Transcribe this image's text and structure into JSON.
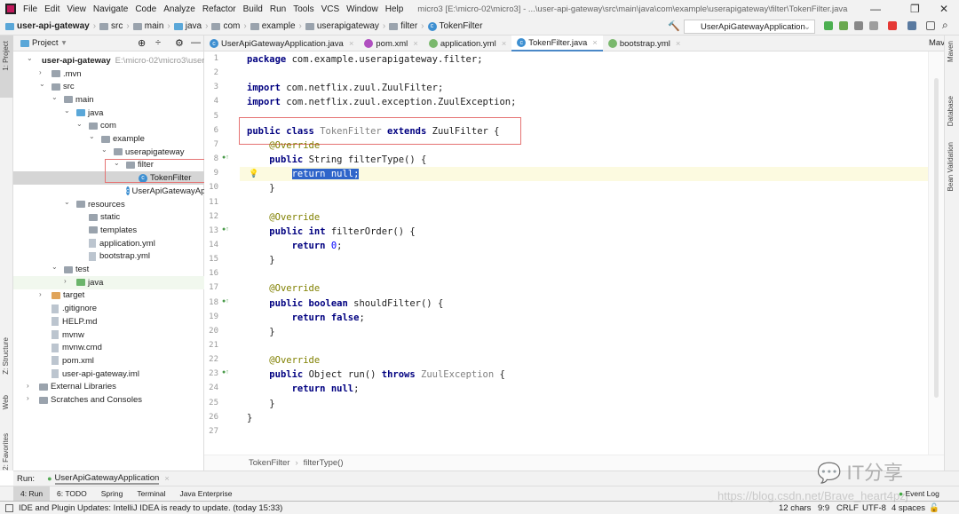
{
  "menu": {
    "items": [
      "File",
      "Edit",
      "View",
      "Navigate",
      "Code",
      "Analyze",
      "Refactor",
      "Build",
      "Run",
      "Tools",
      "VCS",
      "Window",
      "Help"
    ],
    "title": "micro3 [E:\\micro-02\\micro3] - ...\\user-api-gateway\\src\\main\\java\\com\\example\\userapigateway\\filter\\TokenFilter.java"
  },
  "nav": {
    "crumbs": [
      "user-api-gateway",
      "src",
      "main",
      "java",
      "com",
      "example",
      "userapigateway",
      "filter",
      "TokenFilter"
    ],
    "run_config": "UserApiGatewayApplication"
  },
  "left_stripe": {
    "project": "1: Project",
    "structure": "Z: Structure",
    "web": "Web",
    "favorites": "2: Favorites"
  },
  "right_stripe": {
    "maven": "Maven",
    "database": "Database",
    "bean": "Bean Validation"
  },
  "project": {
    "header": "Project",
    "tree": [
      {
        "label": "user-api-gateway",
        "hint": "E:\\micro-02\\micro3\\user-a",
        "depth": 0,
        "open": true,
        "bold": true
      },
      {
        "label": ".mvn",
        "depth": 1,
        "open": false
      },
      {
        "label": "src",
        "depth": 1,
        "open": true
      },
      {
        "label": "main",
        "depth": 2,
        "open": true
      },
      {
        "label": "java",
        "depth": 3,
        "open": true,
        "blue": true
      },
      {
        "label": "com",
        "depth": 4,
        "open": true
      },
      {
        "label": "example",
        "depth": 5,
        "open": true
      },
      {
        "label": "userapigateway",
        "depth": 6,
        "open": true
      },
      {
        "label": "filter",
        "depth": 7,
        "open": true
      },
      {
        "label": "TokenFilter",
        "depth": 8,
        "cls": true,
        "selected": true
      },
      {
        "label": "UserApiGatewayAppl",
        "depth": 7,
        "cls": true
      },
      {
        "label": "resources",
        "depth": 3,
        "open": true
      },
      {
        "label": "static",
        "depth": 4
      },
      {
        "label": "templates",
        "depth": 4
      },
      {
        "label": "application.yml",
        "depth": 4,
        "file": true
      },
      {
        "label": "bootstrap.yml",
        "depth": 4,
        "file": true
      },
      {
        "label": "test",
        "depth": 2,
        "open": true
      },
      {
        "label": "java",
        "depth": 3,
        "open": false,
        "green": true
      },
      {
        "label": "target",
        "depth": 1,
        "open": false,
        "orange": true
      },
      {
        "label": ".gitignore",
        "depth": 1,
        "file": true
      },
      {
        "label": "HELP.md",
        "depth": 1,
        "file": true
      },
      {
        "label": "mvnw",
        "depth": 1,
        "file": true
      },
      {
        "label": "mvnw.cmd",
        "depth": 1,
        "file": true
      },
      {
        "label": "pom.xml",
        "depth": 1,
        "file": true
      },
      {
        "label": "user-api-gateway.iml",
        "depth": 1,
        "file": true
      },
      {
        "label": "External Libraries",
        "depth": 0,
        "open": false
      },
      {
        "label": "Scratches and Consoles",
        "depth": 0,
        "open": false
      }
    ]
  },
  "tabs": [
    {
      "label": "UserApiGatewayApplication.java"
    },
    {
      "label": "pom.xml"
    },
    {
      "label": "application.yml"
    },
    {
      "label": "TokenFilter.java",
      "active": true
    },
    {
      "label": "bootstrap.yml"
    }
  ],
  "tabs_right": "Mav",
  "code": [
    [
      [
        "package ",
        "kw"
      ],
      [
        "com.example.userapigateway.filter;",
        ""
      ]
    ],
    [],
    [
      [
        "import ",
        "kw"
      ],
      [
        "com.netflix.zuul.ZuulFilter;",
        ""
      ]
    ],
    [
      [
        "import ",
        "kw"
      ],
      [
        "com.netflix.zuul.exception.ZuulException;",
        ""
      ]
    ],
    [],
    [
      [
        "public class ",
        "kw"
      ],
      [
        "TokenFilter ",
        "gr"
      ],
      [
        "extends ",
        "kw"
      ],
      [
        "ZuulFilter {",
        ""
      ]
    ],
    [
      [
        "    ",
        ""
      ],
      [
        "@Override",
        "an"
      ]
    ],
    [
      [
        "    ",
        ""
      ],
      [
        "public ",
        "kw"
      ],
      [
        "String filterType() {",
        ""
      ]
    ],
    [
      [
        "        ",
        ""
      ],
      [
        "return null;",
        "selc"
      ]
    ],
    [
      [
        "    }",
        ""
      ]
    ],
    [],
    [
      [
        "    ",
        ""
      ],
      [
        "@Override",
        "an"
      ]
    ],
    [
      [
        "    ",
        ""
      ],
      [
        "public int ",
        "kw"
      ],
      [
        "filterOrder() {",
        ""
      ]
    ],
    [
      [
        "        ",
        ""
      ],
      [
        "return ",
        "kw"
      ],
      [
        "0",
        "nm"
      ],
      [
        ";",
        ""
      ]
    ],
    [
      [
        "    }",
        ""
      ]
    ],
    [],
    [
      [
        "    ",
        ""
      ],
      [
        "@Override",
        "an"
      ]
    ],
    [
      [
        "    ",
        ""
      ],
      [
        "public boolean ",
        "kw"
      ],
      [
        "shouldFilter() {",
        ""
      ]
    ],
    [
      [
        "        ",
        ""
      ],
      [
        "return false",
        "kw"
      ],
      [
        ";",
        ""
      ]
    ],
    [
      [
        "    }",
        ""
      ]
    ],
    [],
    [
      [
        "    ",
        ""
      ],
      [
        "@Override",
        "an"
      ]
    ],
    [
      [
        "    ",
        ""
      ],
      [
        "public ",
        "kw"
      ],
      [
        "Object run() ",
        ""
      ],
      [
        "throws ",
        "kw"
      ],
      [
        "ZuulException ",
        "gr"
      ],
      [
        "{",
        ""
      ]
    ],
    [
      [
        "        ",
        ""
      ],
      [
        "return null",
        "kw"
      ],
      [
        ";",
        ""
      ]
    ],
    [
      [
        "    }",
        ""
      ]
    ],
    [
      [
        "}",
        ""
      ]
    ],
    []
  ],
  "editor_breadcrumb": [
    "TokenFilter",
    "filterType()"
  ],
  "run": {
    "label": "Run:",
    "config": "UserApiGatewayApplication"
  },
  "tool_tabs": [
    "4: Run",
    "6: TODO",
    "Spring",
    "Terminal",
    "Java Enterprise"
  ],
  "status": {
    "message": "IDE and Plugin Updates: IntelliJ IDEA is ready to update. (today 15:33)",
    "chars": "12 chars",
    "pos": "9:9",
    "line_sep": "CRLF",
    "encoding": "UTF-8",
    "indent": "4 spaces",
    "event_log": "Event Log"
  },
  "watermark": {
    "logo": "IT分享",
    "url": "https://blog.csdn.net/Brave_heart4pzj"
  }
}
